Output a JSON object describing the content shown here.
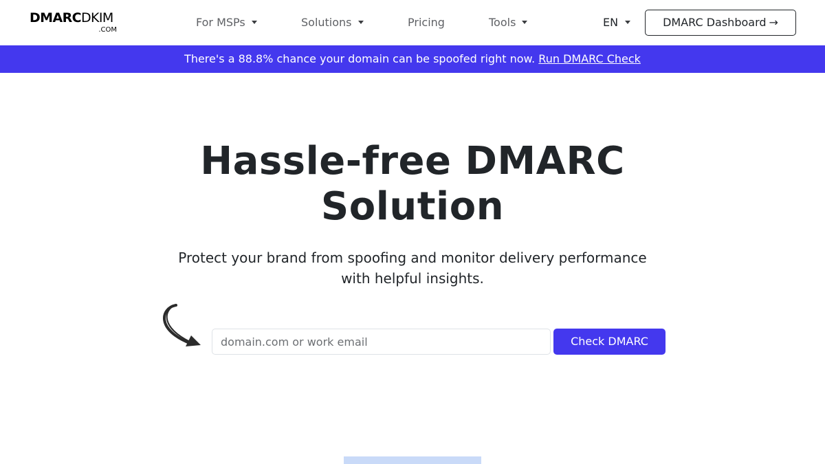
{
  "brand": {
    "logo_bold": "DMARC",
    "logo_regular": "DKIM",
    "logo_suffix": ".COM"
  },
  "nav": {
    "items": [
      {
        "label": "For MSPs",
        "dropdown": true
      },
      {
        "label": "Solutions",
        "dropdown": true
      },
      {
        "label": "Pricing",
        "dropdown": false
      },
      {
        "label": "Tools",
        "dropdown": true
      }
    ],
    "language": "EN",
    "dashboard_button": "DMARC Dashboard",
    "dashboard_arrow": "→"
  },
  "banner": {
    "text": "There's a 88.8% chance your domain can be spoofed right now.",
    "link": "Run DMARC Check"
  },
  "hero": {
    "title": "Hassle-free DMARC Solution",
    "subtitle": "Protect your brand from spoofing and monitor delivery performance with helpful insights.",
    "input_placeholder": "domain.com or work email",
    "input_value": "",
    "check_button": "Check DMARC"
  },
  "colors": {
    "accent": "#4438ee",
    "text": "#212529",
    "muted_nav": "#5f6165",
    "preview": "#c9daf8"
  },
  "icons": {
    "curved_arrow": "curved-arrow-icon",
    "arrow_right": "arrow-right-icon",
    "caret": "caret-down-icon"
  }
}
